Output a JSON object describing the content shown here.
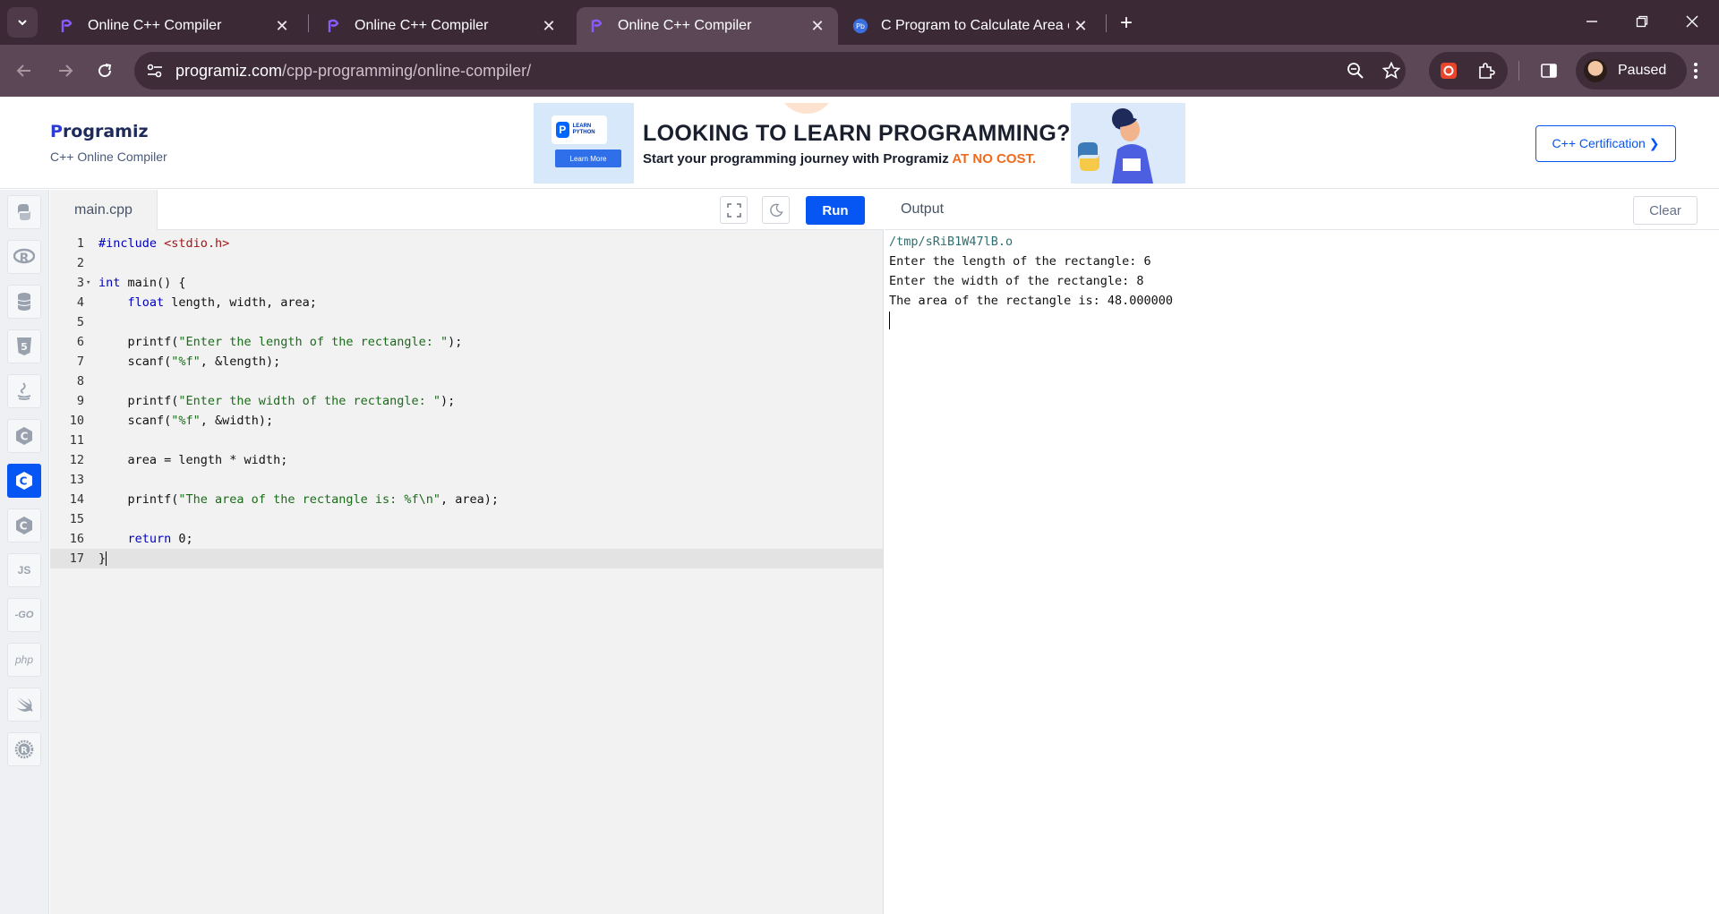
{
  "browser": {
    "tabs": [
      {
        "title": "Online C++ Compiler",
        "active": false
      },
      {
        "title": "Online C++ Compiler",
        "active": false
      },
      {
        "title": "Online C++ Compiler",
        "active": true
      },
      {
        "title": "C Program to Calculate Area of",
        "active": false
      }
    ],
    "url_host": "programiz.com",
    "url_path": "/cpp-programming/online-compiler/",
    "profile_label": "Paused"
  },
  "header": {
    "logo_letter": "P",
    "logo_text": "rogramiz",
    "subtitle": "C++ Online Compiler",
    "certification_label": "C++ Certification ❯"
  },
  "banner": {
    "card_text": "LEARN PYTHON",
    "card_logo": "P",
    "learn_more": "Learn More",
    "title": "LOOKING TO LEARN PROGRAMMING?",
    "subtitle": "Start your programming journey with Programiz ",
    "subtitle_accent": "AT NO COST."
  },
  "languages": [
    {
      "name": "python-icon",
      "glyph": "",
      "active": false
    },
    {
      "name": "r-icon",
      "glyph": "",
      "active": false
    },
    {
      "name": "sql-icon",
      "glyph": "",
      "active": false
    },
    {
      "name": "html-icon",
      "glyph": "",
      "active": false
    },
    {
      "name": "java-icon",
      "glyph": "",
      "active": false
    },
    {
      "name": "c-icon",
      "glyph": "",
      "active": false
    },
    {
      "name": "cpp-icon",
      "glyph": "",
      "active": true
    },
    {
      "name": "csharp-icon",
      "glyph": "",
      "active": false
    },
    {
      "name": "javascript-icon",
      "glyph": "JS",
      "active": false
    },
    {
      "name": "go-icon",
      "glyph": "-GO",
      "active": false
    },
    {
      "name": "php-icon",
      "glyph": "php",
      "active": false
    },
    {
      "name": "swift-icon",
      "glyph": "",
      "active": false
    },
    {
      "name": "rust-icon",
      "glyph": "",
      "active": false
    }
  ],
  "editor": {
    "filename": "main.cpp",
    "run_label": "Run",
    "lines": [
      "#include <stdio.h>",
      "",
      "int main() {",
      "    float length, width, area;",
      "",
      "    printf(\"Enter the length of the rectangle: \");",
      "    scanf(\"%f\", &length);",
      "",
      "    printf(\"Enter the width of the rectangle: \");",
      "    scanf(\"%f\", &width);",
      "",
      "    area = length * width;",
      "",
      "    printf(\"The area of the rectangle is: %f\\n\", area);",
      "",
      "    return 0;",
      "}"
    ],
    "active_line": 17
  },
  "output": {
    "label": "Output",
    "clear_label": "Clear",
    "lines": [
      "/tmp/sRiB1W47lB.o",
      "Enter the length of the rectangle: 6",
      "Enter the width of the rectangle: 8",
      "The area of the rectangle is: 48.000000"
    ]
  },
  "colors": {
    "brand_blue": "#0556f3",
    "chrome_dark": "#3b2a36",
    "chrome_toolbar": "#5c4757",
    "accent_orange": "#f26a1b"
  }
}
